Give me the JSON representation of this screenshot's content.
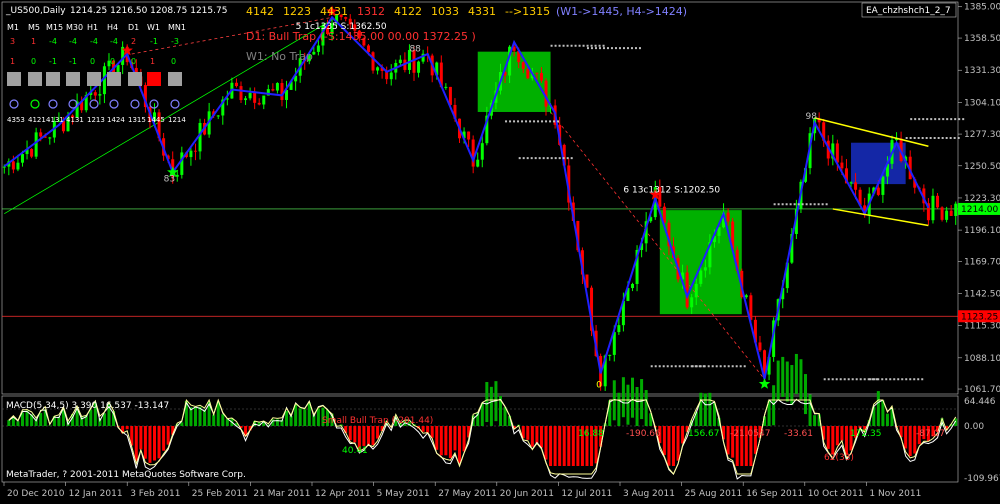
{
  "window": {
    "symbol_title": "_US500,Daily",
    "ohlc": "1214.25 1216.50 1208.75 1215.75",
    "ea_name": "EA_chzhshch1_2_7",
    "copyright": "MetaTrader, ? 2001-2011 MetaQuotes Software Corp."
  },
  "colors": {
    "background": "#000000",
    "bull": "#00ff00",
    "bear": "#ff0000",
    "zigzag": "#2020ff",
    "box": "#00b000",
    "trend": "#00ff00",
    "channel": "#ffff00",
    "macd_hist_pos": "#00aa00",
    "macd_hist_neg": "#ff0000",
    "macd_line": "#ffff99",
    "signal_line": "#ffffff"
  },
  "header_numbers": {
    "values": [
      "4142",
      "1223",
      "4431",
      "1312",
      "4122",
      "1033",
      "4331",
      "-->1315"
    ],
    "highlight_index": 3,
    "projection": "(W1->1445,   H4->1424)"
  },
  "signals": {
    "d1": "D1: Bull Trap (-S:1435.00  00.00 1372.25 )",
    "w1": "W1: No Trap"
  },
  "timeframe_panel": {
    "labels": [
      "M1",
      "M5",
      "M15",
      "M30",
      "H1",
      "H4",
      "D1",
      "W1",
      "MN1"
    ],
    "row1": [
      "3",
      "1",
      "-4",
      "-4",
      "-4",
      "-4",
      "2",
      "-1",
      "-3"
    ],
    "row2": [
      "1",
      "0",
      "-1",
      "-1",
      "0",
      "0",
      "0",
      "1",
      "0"
    ],
    "levels": [
      "4353",
      "4121",
      "4131",
      "4131",
      "1213",
      "1424",
      "1315",
      "1445",
      "1214"
    ]
  },
  "annotations": {
    "low1": "83",
    "top1": "5  1c1335   S:1362.50",
    "top2": "88",
    "mid": "6  13c1312   S:1202.50",
    "right_top": "98",
    "bottom_mark": "0"
  },
  "macd": {
    "label": "MACD(5,34,5) 3.390 16.537 -13.147",
    "small_label": "Small Bull Trap (-201.44)",
    "values": [
      "40.41",
      "16.88",
      "-190.66",
      "156.67",
      "-21.0547",
      "-33.61",
      "172.35",
      "-87.07"
    ],
    "extra": "62(33)",
    "axis_max": "64.446",
    "axis_zero": "0.00",
    "axis_min": "-109.967"
  },
  "chart_data": {
    "type": "candlestick",
    "title": "_US500,Daily",
    "y_ticks": [
      1385.0,
      1358.5,
      1331.3,
      1304.1,
      1277.3,
      1250.5,
      1223.3,
      1196.1,
      1169.7,
      1142.5,
      1115.3,
      1088.1,
      1061.7
    ],
    "ylim": [
      1057.5,
      1389
    ],
    "x_ticks": [
      "20 Dec 2010",
      "12 Jan 2011",
      "3 Feb 2011",
      "25 Feb 2011",
      "21 Mar 2011",
      "12 Apr 2011",
      "5 May 2011",
      "27 May 2011",
      "20 Jun 2011",
      "12 Jul 2011",
      "3 Aug 2011",
      "25 Aug 2011",
      "16 Sep 2011",
      "10 Oct 2011",
      "1 Nov 2011"
    ],
    "current_price": 1214.0,
    "horizontal_levels": [
      1214.0,
      1123.25
    ],
    "zigzag": [
      [
        0,
        1250
      ],
      [
        12,
        1285
      ],
      [
        27,
        1345
      ],
      [
        37,
        1245
      ],
      [
        50,
        1315
      ],
      [
        61,
        1310
      ],
      [
        72,
        1376
      ],
      [
        84,
        1330
      ],
      [
        93,
        1345
      ],
      [
        103,
        1255
      ],
      [
        112,
        1355
      ],
      [
        121,
        1295
      ],
      [
        131,
        1075
      ],
      [
        143,
        1223
      ],
      [
        150,
        1140
      ],
      [
        158,
        1210
      ],
      [
        167,
        1070
      ],
      [
        178,
        1287
      ],
      [
        189,
        1210
      ],
      [
        196,
        1270
      ],
      [
        203,
        1215
      ]
    ],
    "boxes": [
      {
        "x0": 104,
        "x1": 120,
        "y0": 1296,
        "y1": 1347
      },
      {
        "x0": 144,
        "x1": 162,
        "y0": 1125,
        "y1": 1213
      },
      {
        "x0": 186,
        "x1": 198,
        "y0": 1235,
        "y1": 1270
      }
    ],
    "channel": {
      "upper": [
        [
          178,
          1291
        ],
        [
          203,
          1267
        ]
      ],
      "lower": [
        [
          182,
          1214
        ],
        [
          203,
          1200
        ]
      ]
    },
    "trendline": [
      [
        0,
        1210
      ],
      [
        72,
        1374
      ]
    ]
  }
}
